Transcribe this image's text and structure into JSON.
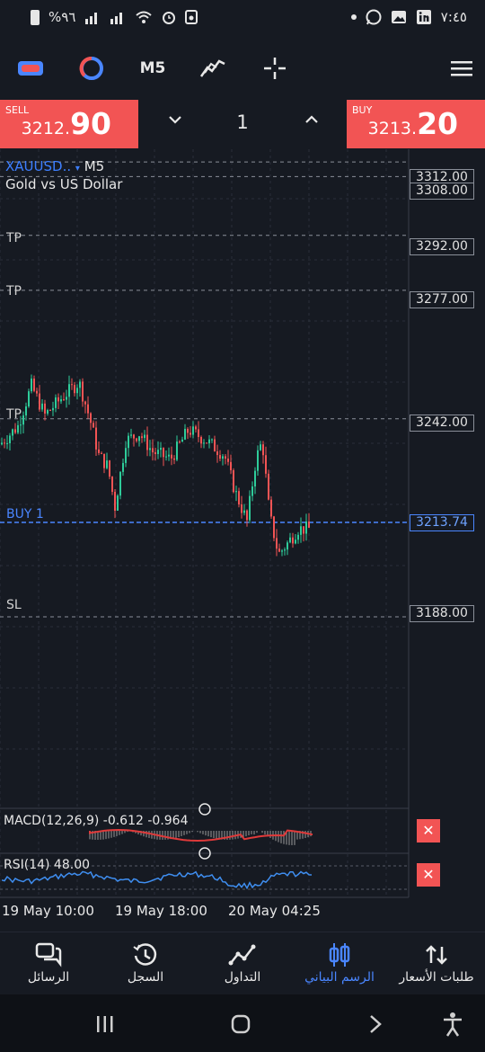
{
  "status_bar": {
    "battery": "%٩٦",
    "time": "٧:٤٥",
    "icons": [
      "battery-icon",
      "signal-icon",
      "wifi-icon",
      "alarm-icon",
      "screen-record-icon",
      "notification-dot-icon",
      "whatsapp-icon",
      "gallery-icon",
      "linkedin-icon"
    ]
  },
  "toolbar": {
    "timeframe": "M5",
    "icons": [
      "symbols-icon",
      "chart-type-icon",
      "indicators-icon",
      "crosshair-icon",
      "menu-icon"
    ]
  },
  "trade": {
    "sell_label": "SELL",
    "sell_price_prefix": "3212.",
    "sell_price_big": "90",
    "buy_label": "BUY",
    "buy_price_prefix": "3213.",
    "buy_price_big": "20",
    "quantity": "1"
  },
  "chart": {
    "symbol": "XAUUSD..",
    "timeframe": "M5",
    "description": "Gold vs US Dollar",
    "price_levels": [
      {
        "price": "3312.00"
      },
      {
        "price": "3308.00"
      },
      {
        "price": "3292.00",
        "label": "TP"
      },
      {
        "price": "3277.00",
        "label": "TP"
      },
      {
        "price": "3242.00",
        "label": "TP"
      },
      {
        "price": "3213.74",
        "label": "BUY 1",
        "active": true
      },
      {
        "price": "3188.00",
        "label": "SL"
      }
    ],
    "macd": {
      "label": "MACD(12,26,9) -0.612 -0.964"
    },
    "rsi": {
      "label": "RSI(14) 48.00"
    },
    "time_axis": [
      "19 May 10:00",
      "19 May 18:00",
      "20 May 04:25"
    ],
    "colors": {
      "up": "#2ecc9a",
      "down": "#f25454",
      "buy_line": "#4a86ff",
      "macd_signal": "#e03a3a",
      "rsi": "#3f8ef0"
    }
  },
  "bottom_nav": {
    "items": [
      {
        "label": "الرسائل",
        "icon": "messages-icon"
      },
      {
        "label": "السجل",
        "icon": "history-icon"
      },
      {
        "label": "التداول",
        "icon": "trade-icon"
      },
      {
        "label": "الرسم البياني",
        "icon": "chart-icon",
        "active": true
      },
      {
        "label": "طلبات الأسعار",
        "icon": "quotes-icon"
      }
    ]
  },
  "system_nav": {
    "icons": [
      "recents-icon",
      "home-icon",
      "back-icon",
      "accessibility-icon"
    ]
  }
}
